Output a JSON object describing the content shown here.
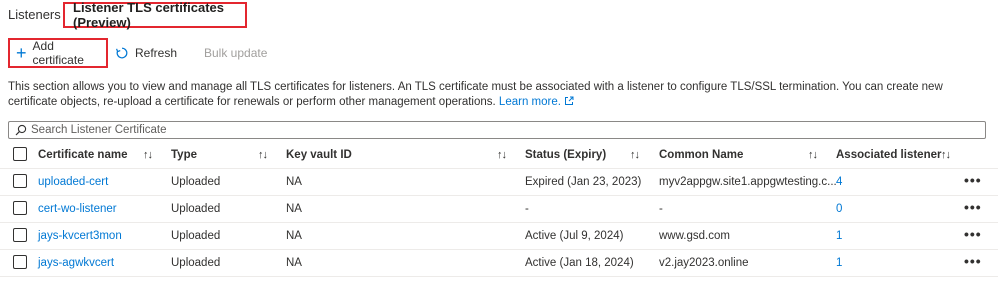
{
  "tabs": [
    {
      "label": "Listeners"
    },
    {
      "label": "Listener TLS certificates (Preview)"
    }
  ],
  "toolbar": {
    "add_label": "Add certificate",
    "refresh_label": "Refresh",
    "bulk_label": "Bulk update"
  },
  "description": {
    "text": "This section allows you to view and manage all TLS certificates for listeners. An TLS certificate must be associated with a listener to configure TLS/SSL termination. You can create new certificate objects, re-upload a certificate for renewals or perform other management operations.",
    "link": "Learn more."
  },
  "search": {
    "placeholder": "Search Listener Certificate",
    "value": ""
  },
  "table": {
    "columns": [
      "Certificate name",
      "Type",
      "Key vault ID",
      "Status (Expiry)",
      "Common Name",
      "Associated listener"
    ],
    "rows": [
      [
        "uploaded-cert",
        "Uploaded",
        "NA",
        "Expired (Jan 23, 2023)",
        "myv2appgw.site1.appgwtesting.c...",
        "4"
      ],
      [
        "cert-wo-listener",
        "Uploaded",
        "NA",
        "-",
        "-",
        "0"
      ],
      [
        "jays-kvcert3mon",
        "Uploaded",
        "NA",
        "Active (Jul 9, 2024)",
        "www.gsd.com",
        "1"
      ],
      [
        "jays-agwkvcert",
        "Uploaded",
        "NA",
        "Active (Jan 18, 2024)",
        "v2.jay2023.online",
        "1"
      ]
    ]
  },
  "colors": {
    "accent": "#0078d4",
    "highlight": "#e3262f"
  }
}
